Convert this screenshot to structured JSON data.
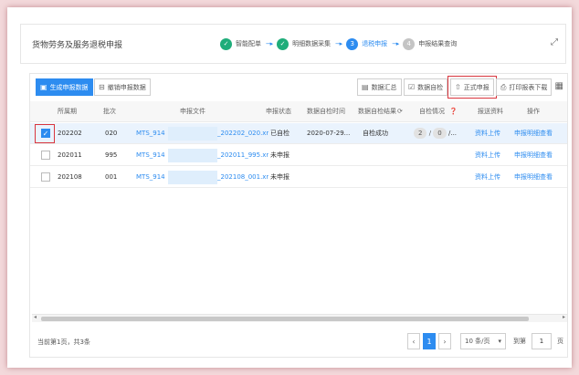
{
  "app": {
    "title": "货物劳务及服务退税申报"
  },
  "steps": [
    {
      "mark": "✓",
      "label": "智能配单",
      "state": "done"
    },
    {
      "mark": "✓",
      "label": "明细数据采集",
      "state": "done"
    },
    {
      "mark": "3",
      "label": "退税申报",
      "state": "active"
    },
    {
      "mark": "4",
      "label": "申报结果查询",
      "state": "todo"
    }
  ],
  "toolbar": {
    "generate_label": "生成申报数据",
    "revoke_label": "撤销申报数据",
    "summary_label": "数据汇总",
    "selfcheck_label": "数据自检",
    "submit_label": "正式申报",
    "print_label": "打印报表下载"
  },
  "table": {
    "columns": [
      "所属期",
      "批次",
      "申报文件",
      "申报状态",
      "数据自检时间",
      "数据自检结果",
      "自检情况",
      "报送资料",
      "操作"
    ],
    "rows": [
      {
        "period": "202202",
        "batch": "020",
        "file_prefix": "MTS_914",
        "file_suffix": "_202202_020.xr",
        "status": "已自检",
        "check_time": "2020-07-29...",
        "check_result": "自检成功",
        "check_a": "2",
        "check_b": "0",
        "check_more": "/...",
        "material": "资料上传",
        "action": "申报明细查看",
        "selected": true
      },
      {
        "period": "202011",
        "batch": "995",
        "file_prefix": "MTS_914",
        "file_suffix": "_202011_995.xr",
        "status": "未申报",
        "check_time": "",
        "check_result": "",
        "check_a": "",
        "check_b": "",
        "check_more": "",
        "material": "资料上传",
        "action": "申报明细查看",
        "selected": false
      },
      {
        "period": "202108",
        "batch": "001",
        "file_prefix": "MTS_914",
        "file_suffix": "_202108_001.xr",
        "status": "未申报",
        "check_time": "",
        "check_result": "",
        "check_a": "",
        "check_b": "",
        "check_more": "",
        "material": "资料上传",
        "action": "申报明细查看",
        "selected": false
      }
    ]
  },
  "footer": {
    "summary": "当前第1页，共3条",
    "current_page": "1",
    "page_size": "10 条/页",
    "goto_label": "到第",
    "goto_value": "1",
    "page_unit": "页"
  },
  "colors": {
    "accent": "#2d8cf0",
    "done": "#1fad7a",
    "highlight": "#d9363e"
  }
}
